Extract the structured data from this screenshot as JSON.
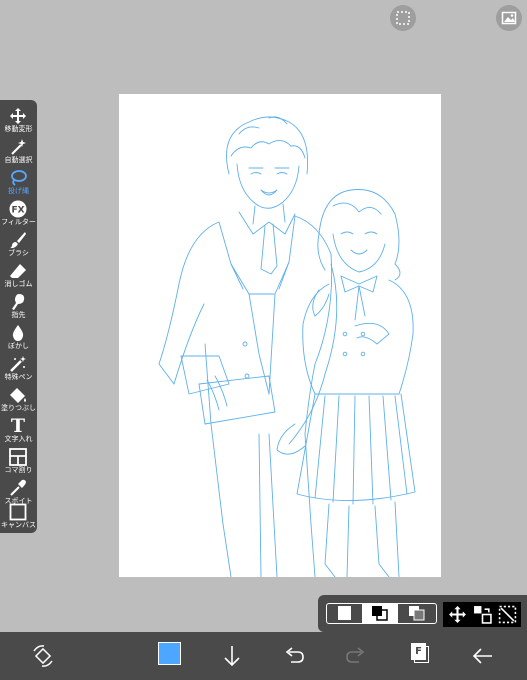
{
  "top_buttons": [
    {
      "name": "selection-icon"
    },
    {
      "name": "photo-icon"
    }
  ],
  "tools": [
    {
      "label": "移動変形",
      "icon": "move-icon"
    },
    {
      "label": "自動選択",
      "icon": "magic-wand-icon"
    },
    {
      "label": "投げ縄",
      "icon": "lasso-icon",
      "active": true
    },
    {
      "label": "フィルター",
      "icon": "fx-icon"
    },
    {
      "label": "ブラシ",
      "icon": "brush-icon"
    },
    {
      "label": "消しゴム",
      "icon": "eraser-icon"
    },
    {
      "label": "指先",
      "icon": "finger-icon"
    },
    {
      "label": "ぼかし",
      "icon": "blur-icon"
    },
    {
      "label": "特殊ペン",
      "icon": "special-pen-icon"
    },
    {
      "label": "塗りつぶし",
      "icon": "fill-icon"
    },
    {
      "label": "文字入れ",
      "icon": "text-icon"
    },
    {
      "label": "コマ割り",
      "icon": "frame-divide-icon"
    },
    {
      "label": "スポイト",
      "icon": "eyedropper-icon"
    },
    {
      "label": "キャンバス",
      "icon": "canvas-icon"
    }
  ],
  "text_tool_glyph": "T",
  "fx_glyph": "FX",
  "layer_modes": [
    "normal-mode-icon",
    "multiply-mode-icon",
    "overlay-mode-icon"
  ],
  "bottom_bar": {
    "color_swatch": "#4da6ff",
    "layer_badge": "F"
  },
  "colors": {
    "accent": "#5aa7ff",
    "line_art": "#5fb0ea"
  }
}
